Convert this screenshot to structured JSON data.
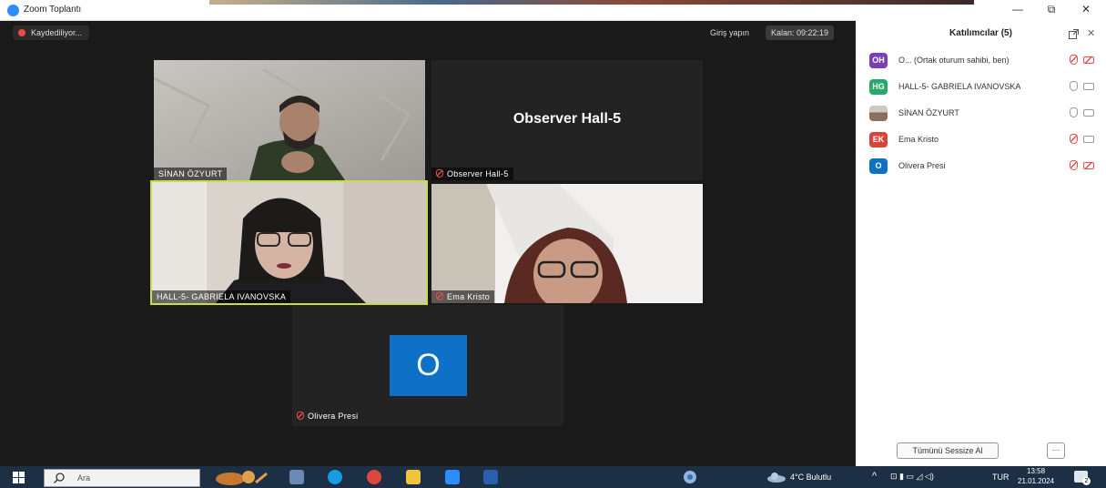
{
  "window": {
    "title": "Zoom Toplantı",
    "min": "—",
    "restore": "⧉",
    "close": "✕"
  },
  "meeting": {
    "recording_label": "Kaydediliyor...",
    "signin_label": "Giriş yapın",
    "remaining_label": "Kalan: 09:22:19"
  },
  "tiles": {
    "sinan": {
      "name": "SİNAN ÖZYURT"
    },
    "observer": {
      "name": "Observer Hall-5",
      "big_name": "Observer Hall-5"
    },
    "gabriela": {
      "name": "HALL-5- GABRIELA IVANOVSKA"
    },
    "ema": {
      "name": "Ema Kristo"
    },
    "olivera": {
      "name": "Olivera Presi",
      "initial": "O"
    }
  },
  "panel": {
    "title": "Katılımcılar (5)",
    "participants": [
      {
        "initials": "OH",
        "name": "O... (Ortak oturum sahibi, ben)",
        "color": "#7b3fb5",
        "mic": "muted",
        "video": "off"
      },
      {
        "initials": "HG",
        "name": "HALL-5- GABRIELA IVANOVSKA",
        "color": "#27a96b",
        "mic": "on",
        "video": "on"
      },
      {
        "initials": "",
        "name": "SİNAN ÖZYURT",
        "color": "#9a8f88",
        "mic": "on",
        "video": "on"
      },
      {
        "initials": "EK",
        "name": "Ema Kristo",
        "color": "#d9443a",
        "mic": "muted",
        "video": "on"
      },
      {
        "initials": "O",
        "name": "Olivera Presi",
        "color": "#0e71c7",
        "mic": "muted",
        "video": "off"
      }
    ],
    "mute_all_label": "Tümünü Sessize Al",
    "more_label": "···"
  },
  "taskbar": {
    "search_placeholder": "Ara",
    "weather": "4°C Bulutlu",
    "language": "TUR",
    "time": "13:58",
    "date": "21.01.2024",
    "notification_count": "2",
    "apps": [
      {
        "name": "task-view",
        "color": "#6a8ab5"
      },
      {
        "name": "edge",
        "color": "#1a9be0"
      },
      {
        "name": "chrome",
        "color": "#e0463b"
      },
      {
        "name": "file-explorer",
        "color": "#f2c33d"
      },
      {
        "name": "zoom",
        "color": "#2d8cff"
      },
      {
        "name": "word",
        "color": "#2b5faa"
      }
    ]
  }
}
